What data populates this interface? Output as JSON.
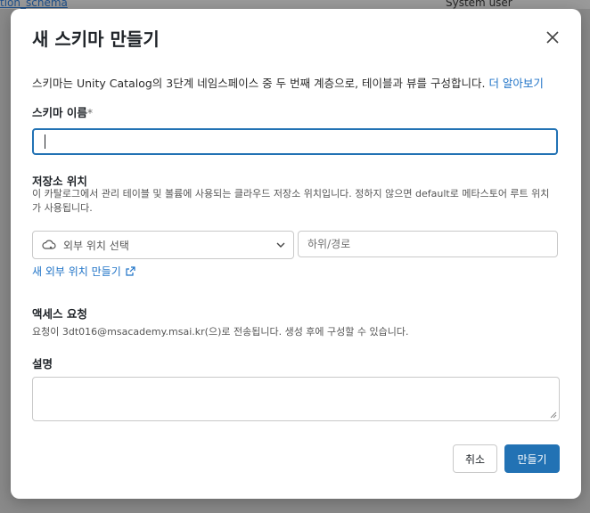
{
  "background": {
    "left_text": "tion_schema",
    "right_text": "System user"
  },
  "dialog": {
    "title": "새 스키마 만들기",
    "description": "스키마는 Unity Catalog의 3단계 네임스페이스 중 두 번째 계층으로, 테이블과 뷰를 구성합니다.",
    "learn_more": "더 알아보기"
  },
  "schema_name": {
    "label": "스키마 이름",
    "required_mark": "*",
    "value": ""
  },
  "storage": {
    "label": "저장소 위치",
    "help": "이 카탈로그에서 관리 테이블 및 볼륨에 사용되는 클라우드 저장소 위치입니다. 정하지 않으면 default로 메타스토어 루트 위치가 사용됩니다.",
    "select_placeholder": "외부 위치 선택",
    "path_placeholder": "하위/경로",
    "new_location_link": "새 외부 위치 만들기"
  },
  "access": {
    "label": "액세스 요청",
    "text": "요청이 3dt016@msacademy.msai.kr(으)로 전송됩니다. 생성 후에 구성할 수 있습니다."
  },
  "description_field": {
    "label": "설명",
    "value": ""
  },
  "buttons": {
    "cancel": "취소",
    "create": "만들기"
  },
  "colors": {
    "primary": "#2272b4",
    "link": "#1f73c7",
    "overlay": "#8a8a8a"
  },
  "icons": {
    "close": "close-icon",
    "cloud": "cloud-icon",
    "chevron": "chevron-down-icon",
    "external": "external-link-icon"
  }
}
